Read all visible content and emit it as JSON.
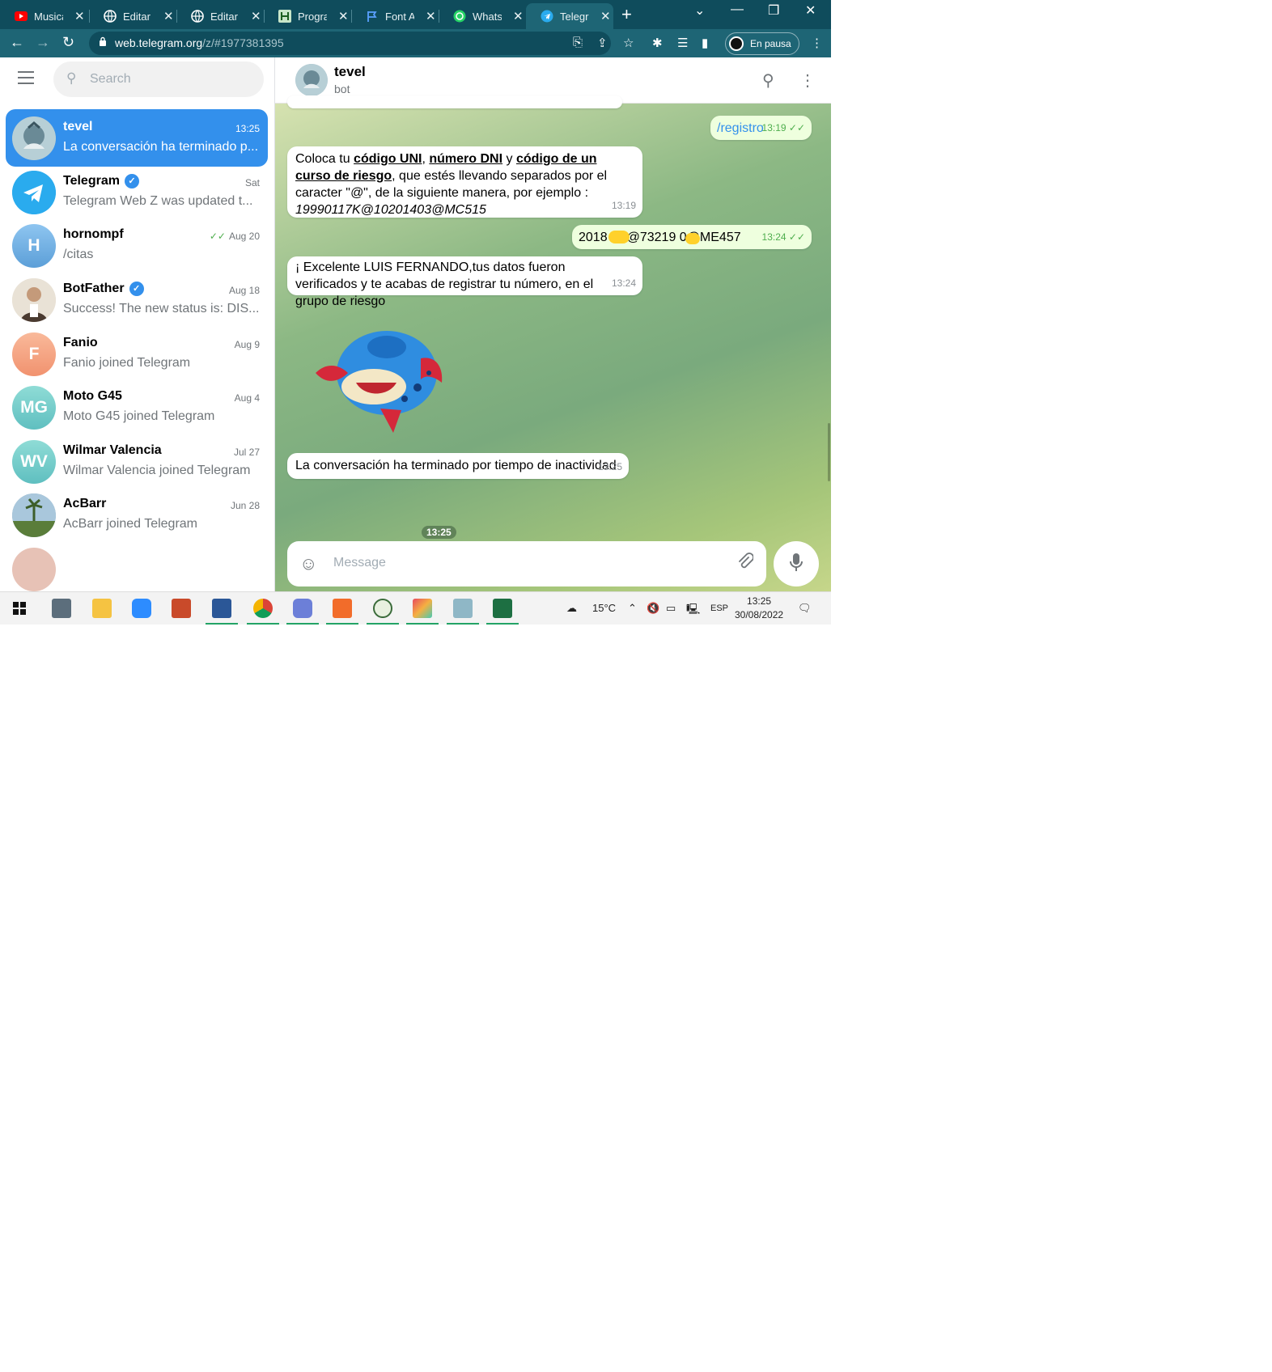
{
  "browser": {
    "tabs": [
      {
        "label": "Musica",
        "icon": "youtube-icon",
        "color": "#ff0000"
      },
      {
        "label": "Editar m",
        "icon": "globe-icon",
        "color": "#ffffff"
      },
      {
        "label": "Editar M",
        "icon": "globe-icon",
        "color": "#ffffff"
      },
      {
        "label": "Progran",
        "icon": "program-icon",
        "color": "#c8e6c9"
      },
      {
        "label": "Font Aw",
        "icon": "flag-icon",
        "color": "#5aa0ff"
      },
      {
        "label": "WhatsA",
        "icon": "whatsapp-icon",
        "color": "#25d366"
      },
      {
        "label": "Telegran",
        "icon": "telegram-icon",
        "color": "#2aabee"
      }
    ],
    "url_host": "web.telegram.org",
    "url_path": "/z/#1977381395",
    "profile_label": "En pausa"
  },
  "sidebar": {
    "search_placeholder": "Search",
    "chats": [
      {
        "name": "tevel",
        "preview": "La conversación ha terminado p...",
        "time": "13:25",
        "selected": true,
        "avatar": "",
        "avatar_color": "#9cb9c5"
      },
      {
        "name": "Telegram",
        "preview": "Telegram Web Z was updated t...",
        "time": "Sat",
        "verified": true,
        "avatar": "",
        "avatar_color": "#2aabee"
      },
      {
        "name": "hornompf",
        "preview": "/citas",
        "time": "Aug 20",
        "read": true,
        "avatar": "H",
        "avatar_color": "#7bb8e8"
      },
      {
        "name": "BotFather",
        "preview": "Success! The new status is: DIS...",
        "time": "Aug 18",
        "verified": true,
        "avatar": "",
        "avatar_color": "#8b6b52"
      },
      {
        "name": "Fanio",
        "preview": "Fanio joined Telegram",
        "time": "Aug 9",
        "avatar": "F",
        "avatar_color": "#f4a585"
      },
      {
        "name": "Moto G45",
        "preview": "Moto G45 joined Telegram",
        "time": "Aug 4",
        "avatar": "MG",
        "avatar_color": "#7fd0cf"
      },
      {
        "name": "Wilmar Valencia",
        "preview": "Wilmar Valencia joined Telegram",
        "time": "Jul 27",
        "avatar": "WV",
        "avatar_color": "#7fd0cf"
      },
      {
        "name": "AcBarr",
        "preview": "AcBarr joined Telegram",
        "time": "Jun 28",
        "avatar": "",
        "avatar_color": "#6f9a55"
      }
    ]
  },
  "chat": {
    "title": "tevel",
    "subtitle": "bot",
    "messages": {
      "m1": {
        "text": "/registro",
        "time": "13:19"
      },
      "m2": {
        "p1": "Coloca tu ",
        "b1": "código UNI",
        "p2": ", ",
        "b2": "número DNI",
        "p3": " y ",
        "b3": "código de un curso de riesgo",
        "p4": ", que estés llevando separados por el caracter \"",
        "at": "@",
        "p5": "\", de la siguiente manera, por ejemplo :",
        "example": "19990117K@10201403@MC515",
        "time": "13:19"
      },
      "m3": {
        "text": "2018 0E@73219 0@ME457",
        "time": "13:24"
      },
      "m4": {
        "text": "¡ Excelente  LUIS FERNANDO,tus datos fueron verificados y te acabas de registrar tu número, en el grupo de riesgo",
        "time": "13:24"
      },
      "sticker": {
        "time": "13:25"
      },
      "m5": {
        "text": "La conversación ha terminado por tiempo de inactividad",
        "time": "13:25"
      }
    },
    "composer_placeholder": "Message"
  },
  "taskbar": {
    "weather": "15°C",
    "lang": "ESP",
    "time": "13:25",
    "date": "30/08/2022"
  }
}
